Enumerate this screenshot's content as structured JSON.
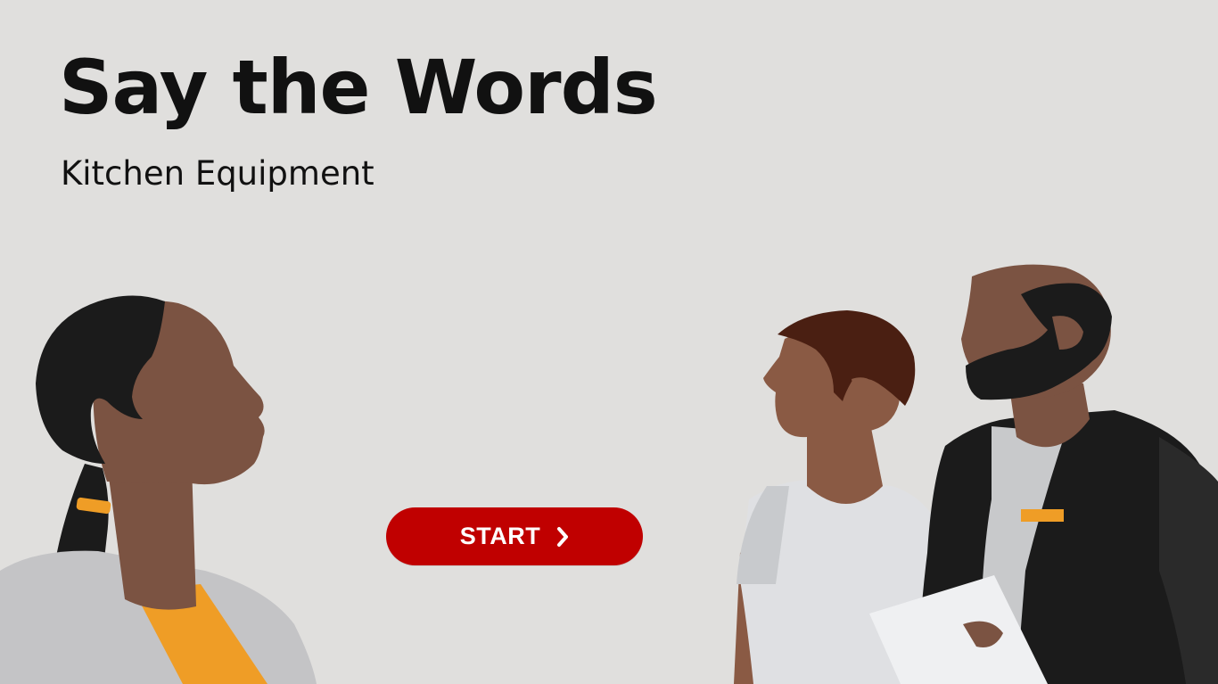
{
  "page": {
    "title": "Say the Words",
    "subtitle": "Kitchen Equipment"
  },
  "start_button": {
    "label": "START",
    "icon": "chevron-right-icon",
    "color": "#c00000"
  },
  "illustration": {
    "background_color": "#e0dfdd",
    "figures": [
      "woman-figure",
      "young-man-figure",
      "bearded-man-figure"
    ]
  }
}
